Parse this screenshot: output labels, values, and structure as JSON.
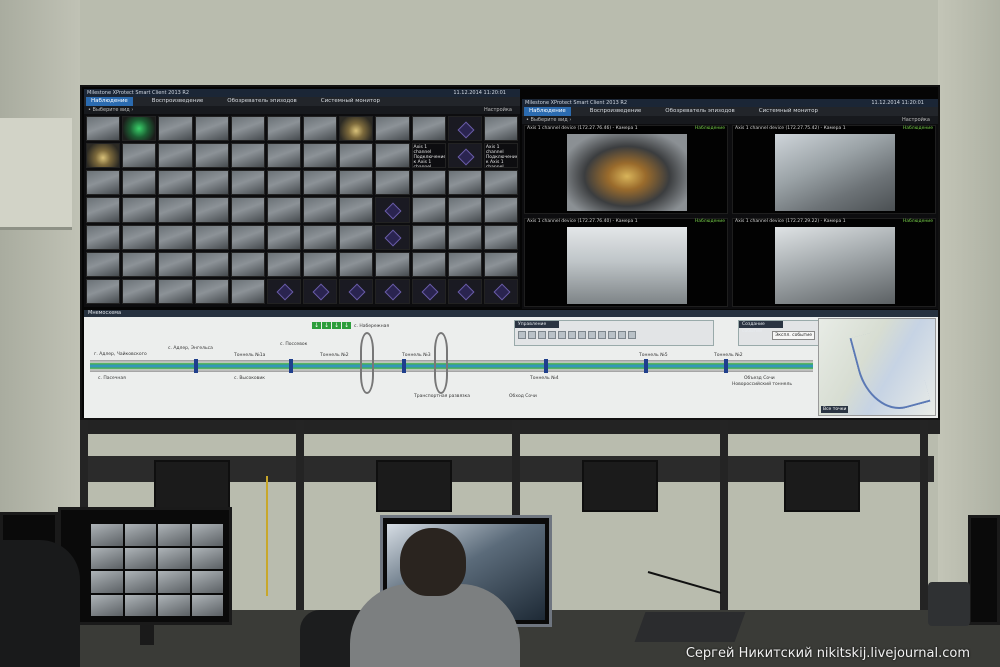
{
  "left_panel": {
    "window_title": "Milestone XProtect Smart Client 2013 R2",
    "clock": "11.12.2014 11:20:01",
    "tabs": [
      "Наблюдение",
      "Воспроизведение",
      "Обозреватель эпизодов",
      "Системный монитор"
    ],
    "toolbar_left": "• Выберите вид ›",
    "toolbar_right": "Настройка",
    "info_tile_1": "Axis 1 channel Подключение к Axis 1 channel device (172.27.72.48) - Камера 1 потеряно.",
    "info_tile_2": "Axis 1 channel Подключение к Axis 1 channel device (172.27.72.44) - Камера 1 потеряно."
  },
  "right_panel": {
    "window_title": "Milestone XProtect Smart Client 2013 R2",
    "clock": "11.12.2014 11:20:01",
    "tabs": [
      "Наблюдение",
      "Воспроизведение",
      "Обозреватель эпизодов",
      "Системный монитор"
    ],
    "toolbar_left": "• Выберите вид ›",
    "toolbar_right": "Настройка",
    "cameras": [
      {
        "label": "Axis 1 channel device (172.27.76.46) - Камера 1",
        "status": "Наблюдение"
      },
      {
        "label": "Axis 1 channel device (172.27.75.42) - Камера 1",
        "status": "Наблюдение"
      },
      {
        "label": "Axis 1 channel device (172.27.76.40) - Камера 1",
        "status": "Наблюдение"
      },
      {
        "label": "Axis 1 channel device (172.27.29.22) - Камера 1",
        "status": "Наблюдение"
      }
    ]
  },
  "map_panel": {
    "title": "Мнемосхема",
    "control_title": "Управление стенкой",
    "event_title": "Создание событий",
    "event_button": "Экспл. событие",
    "minimap_button": "Все точки",
    "labels": [
      "г. Адлер, Чайковского",
      "с. Адлер, Энгельса",
      "с. Поссевок",
      "Тоннель №1а",
      "Тоннель №2",
      "с. Пасечная",
      "с. Высоковик",
      "Тоннель №3",
      "Тоннель №4",
      "Тоннель №5",
      "Тоннель №2",
      "Обход Сочи",
      "Объезд Сочи",
      "с. Набережная",
      "Транспортная развязка",
      "Новороссийский тоннель"
    ]
  },
  "watermark": "Сергей Никитский nikitskij.livejournal.com"
}
